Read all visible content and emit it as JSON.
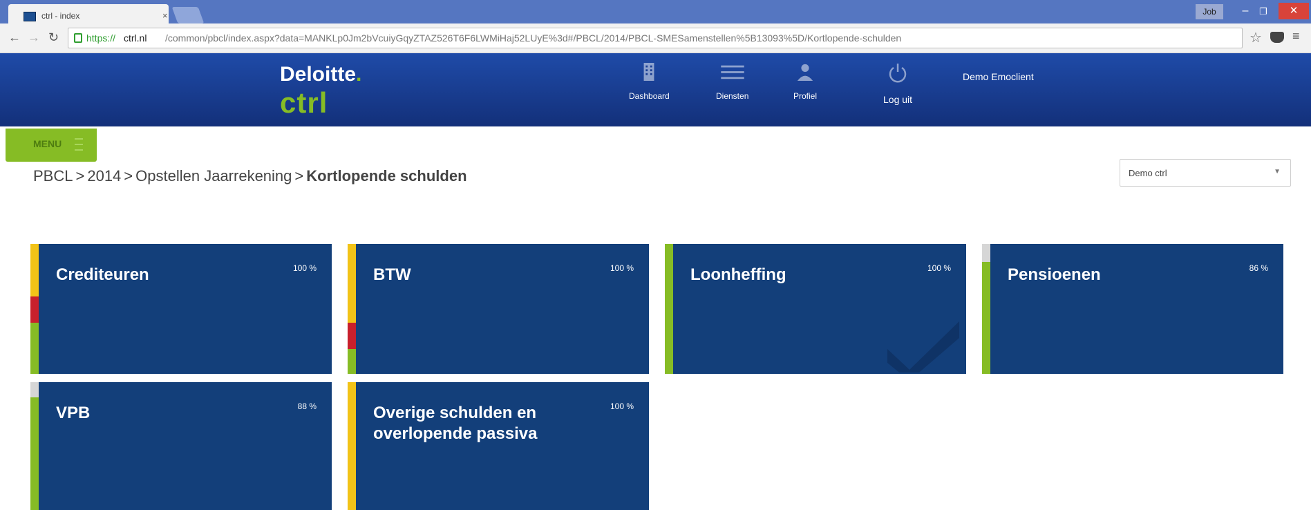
{
  "browser": {
    "tab_title": "ctrl - index",
    "tab_close": "×",
    "user_badge": "Job",
    "url_scheme": "https://",
    "url_host": "ctrl.nl",
    "url_path": "/common/pbcl/index.aspx?data=MANKLp0Jm2bVcuiyGqyZTAZ526T6F6LWMiHaj52LUyE%3d#/PBCL/2014/PBCL-SMESamenstellen%5B13093%5D/Kortlopende-schulden"
  },
  "header": {
    "logo_text": "Deloitte",
    "logo_dot": ".",
    "logo_ctrl": "ctrl",
    "nav": [
      {
        "label": "Dashboard"
      },
      {
        "label": "Diensten"
      },
      {
        "label": "Profiel"
      },
      {
        "label": "Log uit"
      }
    ],
    "user_name": "Demo Emoclient"
  },
  "menu": {
    "label": "MENU"
  },
  "breadcrumb": {
    "items": [
      "PBCL",
      "2014",
      "Opstellen Jaarrekening"
    ],
    "separator": ">",
    "current": "Kortlopende schulden"
  },
  "client_select": {
    "value": "Demo ctrl",
    "caret": "▼"
  },
  "tiles": [
    {
      "title": "Crediteuren",
      "percent": "100 %",
      "progress": 1.0
    },
    {
      "title": "BTW",
      "percent": "100 %",
      "progress": 1.0
    },
    {
      "title": "Loonheffing",
      "percent": "100 %",
      "progress": 1.0,
      "completed": true
    },
    {
      "title": "Pensioenen",
      "percent": "86 %",
      "progress": 0.86
    },
    {
      "title": "VPB",
      "percent": "88 %",
      "progress": 0.88
    },
    {
      "title": "Overige schulden en overlopende passiva",
      "percent": "100 %",
      "progress": 1.0
    }
  ],
  "colors": {
    "header_bg": "#1a3b8c",
    "tile_bg": "#133f7a",
    "accent_green": "#86bc25",
    "status_yellow": "#f2c318",
    "status_red": "#c8202c",
    "status_grey": "#d6d6d6"
  }
}
